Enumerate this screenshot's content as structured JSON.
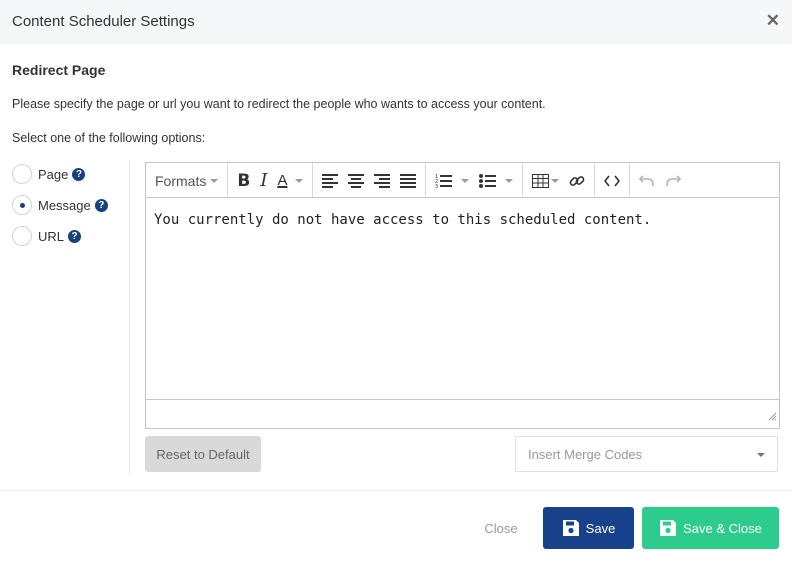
{
  "dialog": {
    "title": "Content Scheduler Settings",
    "close_icon": "close-icon"
  },
  "section": {
    "title": "Redirect Page",
    "description": "Please specify the page or url you want to redirect the people who wants to access your content.",
    "select_label": "Select one of the following options:"
  },
  "options": [
    {
      "label": "Page",
      "selected": false,
      "help_icon": "help-icon"
    },
    {
      "label": "Message",
      "selected": true,
      "help_icon": "help-icon"
    },
    {
      "label": "URL",
      "selected": false,
      "help_icon": "help-icon"
    }
  ],
  "editor": {
    "toolbar": {
      "formats_label": "Formats",
      "icons": [
        "bold-icon",
        "italic-icon",
        "text-color-icon",
        "align-left-icon",
        "align-center-icon",
        "align-right-icon",
        "align-justify-icon",
        "numbered-list-icon",
        "bullet-list-icon",
        "table-icon",
        "link-icon",
        "source-code-icon",
        "undo-icon",
        "redo-icon"
      ]
    },
    "content": "You currently do not have access to this scheduled content."
  },
  "actions": {
    "reset_label": "Reset to Default",
    "merge_placeholder": "Insert Merge Codes"
  },
  "footer": {
    "close_label": "Close",
    "save_label": "Save",
    "save_close_label": "Save & Close"
  },
  "colors": {
    "primary": "#17418b",
    "success": "#2ecc8c",
    "help_icon": "#16437e"
  }
}
